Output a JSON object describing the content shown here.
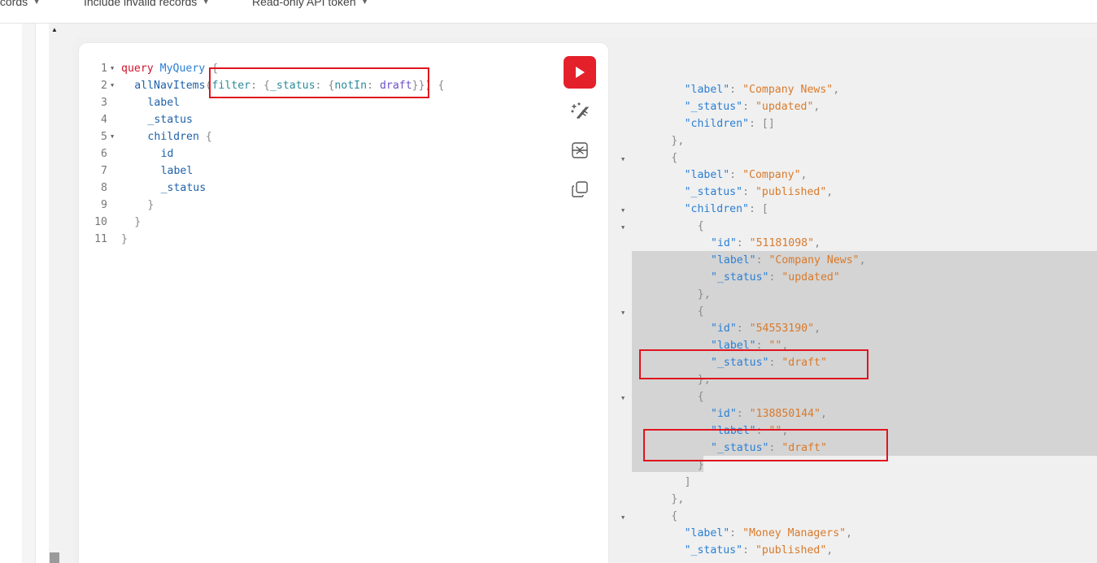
{
  "topbar": {
    "items": [
      {
        "label": "Records"
      },
      {
        "label": "Include invalid records"
      },
      {
        "label": "Read-only API token"
      }
    ]
  },
  "editor": {
    "lines": [
      {
        "n": "1",
        "fold": true,
        "indent": 0,
        "tokens": [
          [
            "kw",
            "query"
          ],
          [
            "sp",
            " "
          ],
          [
            "def",
            "MyQuery"
          ],
          [
            "sp",
            " "
          ],
          [
            "punct",
            "{"
          ]
        ]
      },
      {
        "n": "2",
        "fold": true,
        "indent": 1,
        "tokens": [
          [
            "field",
            "allNavItems"
          ],
          [
            "punct",
            "("
          ],
          [
            "arg",
            "filter"
          ],
          [
            "punct",
            ": {"
          ],
          [
            "arg",
            "_status"
          ],
          [
            "punct",
            ": {"
          ],
          [
            "arg",
            "notIn"
          ],
          [
            "punct",
            ": "
          ],
          [
            "enumv",
            "draft"
          ],
          [
            "punct",
            "}})"
          ],
          [
            "sp",
            " "
          ],
          [
            "punct",
            "{"
          ]
        ]
      },
      {
        "n": "3",
        "fold": false,
        "indent": 2,
        "tokens": [
          [
            "field",
            "label"
          ]
        ]
      },
      {
        "n": "4",
        "fold": false,
        "indent": 2,
        "tokens": [
          [
            "field",
            "_status"
          ]
        ]
      },
      {
        "n": "5",
        "fold": true,
        "indent": 2,
        "tokens": [
          [
            "field",
            "children"
          ],
          [
            "sp",
            " "
          ],
          [
            "punct",
            "{"
          ]
        ]
      },
      {
        "n": "6",
        "fold": false,
        "indent": 3,
        "tokens": [
          [
            "field",
            "id"
          ]
        ]
      },
      {
        "n": "7",
        "fold": false,
        "indent": 3,
        "tokens": [
          [
            "field",
            "label"
          ]
        ]
      },
      {
        "n": "8",
        "fold": false,
        "indent": 3,
        "tokens": [
          [
            "field",
            "_status"
          ]
        ]
      },
      {
        "n": "9",
        "fold": false,
        "indent": 2,
        "tokens": [
          [
            "punct",
            "}"
          ]
        ]
      },
      {
        "n": "10",
        "fold": false,
        "indent": 1,
        "tokens": [
          [
            "punct",
            "}"
          ]
        ]
      },
      {
        "n": "11",
        "fold": false,
        "indent": 0,
        "tokens": [
          [
            "punct",
            "}"
          ]
        ]
      }
    ]
  },
  "toolbar": {
    "run_icon": "play-icon",
    "prettify_icon": "magic-wand-icon",
    "merge_icon": "merge-fragments-icon",
    "copy_icon": "copy-icon"
  },
  "results": {
    "lines": [
      {
        "indent": 3,
        "fold": false,
        "tokens": [
          [
            "key",
            "\"label\""
          ],
          [
            "pn",
            ": "
          ],
          [
            "str",
            "\"Company News\""
          ],
          [
            "pn",
            ","
          ]
        ]
      },
      {
        "indent": 3,
        "fold": false,
        "tokens": [
          [
            "key",
            "\"_status\""
          ],
          [
            "pn",
            ": "
          ],
          [
            "str",
            "\"updated\""
          ],
          [
            "pn",
            ","
          ]
        ]
      },
      {
        "indent": 3,
        "fold": false,
        "tokens": [
          [
            "key",
            "\"children\""
          ],
          [
            "pn",
            ": []"
          ]
        ]
      },
      {
        "indent": 2,
        "fold": false,
        "tokens": [
          [
            "pn",
            "},"
          ]
        ]
      },
      {
        "indent": 2,
        "fold": true,
        "tokens": [
          [
            "pn",
            "{"
          ]
        ]
      },
      {
        "indent": 3,
        "fold": false,
        "tokens": [
          [
            "key",
            "\"label\""
          ],
          [
            "pn",
            ": "
          ],
          [
            "str",
            "\"Company\""
          ],
          [
            "pn",
            ","
          ]
        ]
      },
      {
        "indent": 3,
        "fold": false,
        "tokens": [
          [
            "key",
            "\"_status\""
          ],
          [
            "pn",
            ": "
          ],
          [
            "str",
            "\"published\""
          ],
          [
            "pn",
            ","
          ]
        ]
      },
      {
        "indent": 3,
        "fold": true,
        "tokens": [
          [
            "key",
            "\"children\""
          ],
          [
            "pn",
            ": ["
          ]
        ]
      },
      {
        "indent": 4,
        "fold": true,
        "tokens": [
          [
            "pn",
            "{"
          ]
        ]
      },
      {
        "indent": 5,
        "fold": false,
        "tokens": [
          [
            "key",
            "\"id\""
          ],
          [
            "pn",
            ": "
          ],
          [
            "str",
            "\"51181098\""
          ],
          [
            "pn",
            ","
          ]
        ]
      },
      {
        "indent": 5,
        "fold": false,
        "tokens": [
          [
            "key",
            "\"label\""
          ],
          [
            "pn",
            ": "
          ],
          [
            "str",
            "\"Company News\""
          ],
          [
            "pn",
            ","
          ]
        ]
      },
      {
        "indent": 5,
        "fold": false,
        "tokens": [
          [
            "key",
            "\"_status\""
          ],
          [
            "pn",
            ": "
          ],
          [
            "str",
            "\"updated\""
          ]
        ]
      },
      {
        "indent": 4,
        "fold": false,
        "tokens": [
          [
            "pn",
            "},"
          ]
        ]
      },
      {
        "indent": 4,
        "fold": true,
        "tokens": [
          [
            "pn",
            "{"
          ]
        ]
      },
      {
        "indent": 5,
        "fold": false,
        "tokens": [
          [
            "key",
            "\"id\""
          ],
          [
            "pn",
            ": "
          ],
          [
            "str",
            "\"54553190\""
          ],
          [
            "pn",
            ","
          ]
        ]
      },
      {
        "indent": 5,
        "fold": false,
        "tokens": [
          [
            "key",
            "\"label\""
          ],
          [
            "pn",
            ": "
          ],
          [
            "str",
            "\"\""
          ],
          [
            "pn",
            ","
          ]
        ]
      },
      {
        "indent": 5,
        "fold": false,
        "tokens": [
          [
            "key",
            "\"_status\""
          ],
          [
            "pn",
            ": "
          ],
          [
            "str",
            "\"draft\""
          ]
        ]
      },
      {
        "indent": 4,
        "fold": false,
        "tokens": [
          [
            "pn",
            "},"
          ]
        ]
      },
      {
        "indent": 4,
        "fold": true,
        "tokens": [
          [
            "pn",
            "{"
          ]
        ]
      },
      {
        "indent": 5,
        "fold": false,
        "tokens": [
          [
            "key",
            "\"id\""
          ],
          [
            "pn",
            ": "
          ],
          [
            "str",
            "\"138850144\""
          ],
          [
            "pn",
            ","
          ]
        ]
      },
      {
        "indent": 5,
        "fold": false,
        "tokens": [
          [
            "key",
            "\"label\""
          ],
          [
            "pn",
            ": "
          ],
          [
            "str",
            "\"\""
          ],
          [
            "pn",
            ","
          ]
        ]
      },
      {
        "indent": 5,
        "fold": false,
        "tokens": [
          [
            "key",
            "\"_status\""
          ],
          [
            "pn",
            ": "
          ],
          [
            "str",
            "\"draft\""
          ]
        ]
      },
      {
        "indent": 4,
        "fold": false,
        "tokens": [
          [
            "pn",
            "}"
          ]
        ]
      },
      {
        "indent": 3,
        "fold": false,
        "tokens": [
          [
            "pn",
            "]"
          ]
        ]
      },
      {
        "indent": 2,
        "fold": false,
        "tokens": [
          [
            "pn",
            "},"
          ]
        ]
      },
      {
        "indent": 2,
        "fold": true,
        "tokens": [
          [
            "pn",
            "{"
          ]
        ]
      },
      {
        "indent": 3,
        "fold": false,
        "tokens": [
          [
            "key",
            "\"label\""
          ],
          [
            "pn",
            ": "
          ],
          [
            "str",
            "\"Money Managers\""
          ],
          [
            "pn",
            ","
          ]
        ]
      },
      {
        "indent": 3,
        "fold": false,
        "tokens": [
          [
            "key",
            "\"_status\""
          ],
          [
            "pn",
            ": "
          ],
          [
            "str",
            "\"published\""
          ],
          [
            "pn",
            ","
          ]
        ]
      }
    ]
  },
  "colors": {
    "run_button": "#e4202b",
    "annotation_box": "#e0141e"
  }
}
